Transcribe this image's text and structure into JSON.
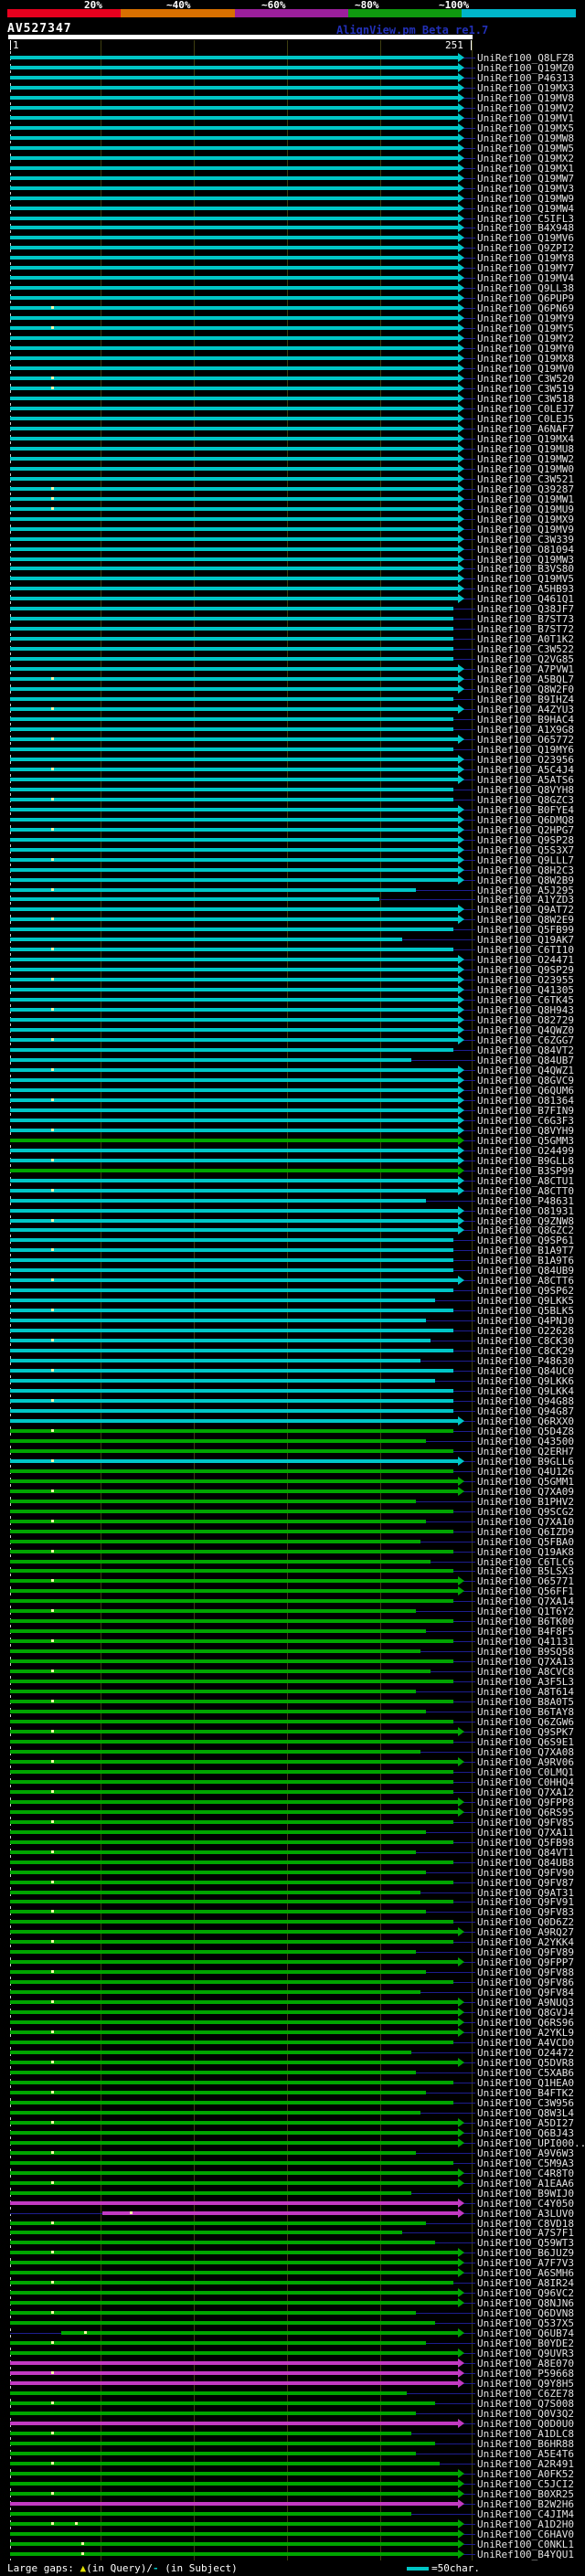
{
  "header": {
    "identity_key": {
      "labels": [
        "20%",
        "~40%",
        "~60%",
        "~80%",
        "~100%"
      ],
      "colors": [
        "#e8001e",
        "#d97000",
        "#9c1f9c",
        "#0f9b0f",
        "#00b7cb"
      ]
    },
    "title": "AV527347",
    "app_title": "AlignView.pm Beta re1.7"
  },
  "scale": {
    "start_label": "1",
    "end_label": "251"
  },
  "legend": {
    "large_gaps_prefix": "Large gaps: ",
    "triangle_symbol": "▲",
    "query_text": "(in Query)/",
    "dash_symbol": "-",
    "subject_text": " (in Subject)",
    "scale_swatch_label": "=50char."
  },
  "label_prefix": "UniRef100_",
  "colors": {
    "cyan": "#00c6c6",
    "green": "#00a400",
    "magenta": "#c23ac2",
    "connector": "#1d1d8f",
    "grid": "#3e3e10",
    "marker": "#f5f5a5"
  },
  "chart_data": {
    "type": "bar",
    "subtype": "sequence-alignment-coverage",
    "title": "AV527347",
    "x_axis": {
      "min": 1,
      "max": 251,
      "tick_interval": 50
    },
    "identity_bins": [
      "20%",
      "~40%",
      "~60%",
      "~80%",
      "~100%"
    ],
    "row_format": "[accession_suffix, color(c=cyan,g=green,m=magenta), arrowhead(1/0), end_fraction(optional), gap_marker_fractions(optional), start_fraction(optional)]",
    "rows": [
      [
        "Q8LFZ8",
        "c",
        1
      ],
      [
        "Q19MZ0",
        "c",
        1
      ],
      [
        "P46313",
        "c",
        1
      ],
      [
        "Q19MX3",
        "c",
        1
      ],
      [
        "Q19MV8",
        "c",
        1
      ],
      [
        "Q19MV2",
        "c",
        1
      ],
      [
        "Q19MV1",
        "c",
        1
      ],
      [
        "Q19MX5",
        "c",
        1
      ],
      [
        "Q19MW8",
        "c",
        1
      ],
      [
        "Q19MW5",
        "c",
        1
      ],
      [
        "Q19MX2",
        "c",
        1
      ],
      [
        "Q19MX1",
        "c",
        1
      ],
      [
        "Q19MW7",
        "c",
        1
      ],
      [
        "Q19MV3",
        "c",
        1
      ],
      [
        "Q19MW9",
        "c",
        1
      ],
      [
        "Q19MW4",
        "c",
        1
      ],
      [
        "C5IFL3",
        "c",
        1
      ],
      [
        "B4X948",
        "c",
        1
      ],
      [
        "Q19MV6",
        "c",
        1
      ],
      [
        "Q9ZPI2",
        "c",
        1
      ],
      [
        "Q19MY8",
        "c",
        1
      ],
      [
        "Q19MY7",
        "c",
        1
      ],
      [
        "Q19MV4",
        "c",
        1
      ],
      [
        "Q9LL38",
        "c",
        1
      ],
      [
        "Q6PUP9",
        "c",
        1
      ],
      [
        "Q6PN69",
        "c",
        1,
        null,
        [
          0.09
        ]
      ],
      [
        "Q19MY9",
        "c",
        1
      ],
      [
        "Q19MY5",
        "c",
        1,
        null,
        [
          0.09
        ]
      ],
      [
        "Q19MY2",
        "c",
        1
      ],
      [
        "Q19MY0",
        "c",
        1
      ],
      [
        "Q19MX8",
        "c",
        1
      ],
      [
        "Q19MV0",
        "c",
        1
      ],
      [
        "C3W520",
        "c",
        1,
        null,
        [
          0.09
        ]
      ],
      [
        "C3W519",
        "c",
        1,
        null,
        [
          0.09
        ]
      ],
      [
        "C3W518",
        "c",
        1
      ],
      [
        "C0LEJ7",
        "c",
        1
      ],
      [
        "C0LEJ5",
        "c",
        1
      ],
      [
        "A6NAF7",
        "c",
        1
      ],
      [
        "Q19MX4",
        "c",
        1
      ],
      [
        "Q19MU8",
        "c",
        1
      ],
      [
        "Q19MW2",
        "c",
        1
      ],
      [
        "Q19MW0",
        "c",
        1
      ],
      [
        "C3W521",
        "c",
        1
      ],
      [
        "Q39287",
        "c",
        1,
        null,
        [
          0.09
        ]
      ],
      [
        "Q19MW1",
        "c",
        1,
        null,
        [
          0.09
        ]
      ],
      [
        "Q19MU9",
        "c",
        1,
        null,
        [
          0.09
        ]
      ],
      [
        "Q19MX9",
        "c",
        1
      ],
      [
        "Q19MV9",
        "c",
        1
      ],
      [
        "C3W339",
        "c",
        1
      ],
      [
        "O81094",
        "c",
        1
      ],
      [
        "Q19MW3",
        "c",
        1
      ],
      [
        "B3VS80",
        "c",
        1
      ],
      [
        "Q19MV5",
        "c",
        1
      ],
      [
        "A5HB93",
        "c",
        1
      ],
      [
        "Q461Q1",
        "c",
        1
      ],
      [
        "Q38JF7",
        "c",
        0
      ],
      [
        "B7ST73",
        "c",
        0
      ],
      [
        "B7ST72",
        "c",
        0
      ],
      [
        "A0T1K2",
        "c",
        0
      ],
      [
        "C3W522",
        "c",
        0
      ],
      [
        "Q2VG85",
        "c",
        0
      ],
      [
        "A7PVW1",
        "c",
        1
      ],
      [
        "A5BQL7",
        "c",
        1,
        null,
        [
          0.09
        ]
      ],
      [
        "Q8W2F0",
        "c",
        1
      ],
      [
        "B9IHZ4",
        "c",
        0
      ],
      [
        "A4ZYU3",
        "c",
        1,
        null,
        [
          0.09
        ]
      ],
      [
        "B9HAC4",
        "c",
        0
      ],
      [
        "A1X9G8",
        "c",
        0
      ],
      [
        "O65772",
        "c",
        1,
        null,
        [
          0.09
        ]
      ],
      [
        "Q19MY6",
        "c",
        0
      ],
      [
        "O23956",
        "c",
        1
      ],
      [
        "A5C4J4",
        "c",
        1,
        null,
        [
          0.09
        ]
      ],
      [
        "A5ATS6",
        "c",
        1
      ],
      [
        "Q8VYH8",
        "c",
        0
      ],
      [
        "Q8GZC3",
        "c",
        0,
        null,
        [
          0.09
        ]
      ],
      [
        "B0FYE4",
        "c",
        1
      ],
      [
        "Q6DMQ8",
        "c",
        1
      ],
      [
        "Q2HPG7",
        "c",
        1,
        null,
        [
          0.09
        ]
      ],
      [
        "Q9SP28",
        "c",
        1
      ],
      [
        "Q5S3X7",
        "c",
        1
      ],
      [
        "Q9LLL7",
        "c",
        1,
        null,
        [
          0.09
        ]
      ],
      [
        "Q8H2C3",
        "c",
        1
      ],
      [
        "Q8W2B9",
        "c",
        1
      ],
      [
        "A5J295",
        "c",
        0,
        0.88,
        [
          0.09
        ]
      ],
      [
        "A1YZD3",
        "c",
        0,
        0.8
      ],
      [
        "Q9AT72",
        "c",
        1
      ],
      [
        "Q8W2E9",
        "c",
        1,
        null,
        [
          0.09
        ]
      ],
      [
        "Q5FB99",
        "c",
        0
      ],
      [
        "Q19AK7",
        "c",
        0,
        0.85
      ],
      [
        "C6TI10",
        "c",
        0,
        null,
        [
          0.09
        ]
      ],
      [
        "O24471",
        "c",
        1
      ],
      [
        "Q9SP29",
        "c",
        1
      ],
      [
        "O23955",
        "c",
        1,
        null,
        [
          0.09
        ]
      ],
      [
        "Q41305",
        "c",
        1
      ],
      [
        "C6TK45",
        "c",
        1
      ],
      [
        "Q8H943",
        "c",
        1,
        null,
        [
          0.09
        ]
      ],
      [
        "O82729",
        "c",
        1
      ],
      [
        "Q4QWZ0",
        "c",
        1
      ],
      [
        "C6ZGG7",
        "c",
        1,
        null,
        [
          0.09
        ]
      ],
      [
        "Q84VT2",
        "c",
        0
      ],
      [
        "Q84UB7",
        "c",
        0,
        0.87
      ],
      [
        "Q4QWZ1",
        "c",
        1,
        null,
        [
          0.09
        ]
      ],
      [
        "Q8GVC9",
        "c",
        1
      ],
      [
        "Q6QUM6",
        "c",
        1
      ],
      [
        "O81364",
        "c",
        1,
        null,
        [
          0.09
        ]
      ],
      [
        "B7FIN9",
        "c",
        1
      ],
      [
        "C6G3F3",
        "c",
        1
      ],
      [
        "Q8VYH9",
        "c",
        1,
        null,
        [
          0.09
        ]
      ],
      [
        "Q5GMM3",
        "g",
        1
      ],
      [
        "O24499",
        "c",
        1
      ],
      [
        "B9GLL8",
        "c",
        1,
        null,
        [
          0.09
        ]
      ],
      [
        "B3SP99",
        "g",
        1
      ],
      [
        "A8CTU1",
        "c",
        1
      ],
      [
        "A8CTT0",
        "c",
        1,
        null,
        [
          0.09
        ]
      ],
      [
        "P48631",
        "c",
        0,
        0.9
      ],
      [
        "O81931",
        "c",
        1
      ],
      [
        "Q9ZNW8",
        "c",
        1,
        null,
        [
          0.09
        ]
      ],
      [
        "Q8GZC2",
        "c",
        1
      ],
      [
        "Q9SP61",
        "c",
        0
      ],
      [
        "B1A9T7",
        "c",
        0,
        null,
        [
          0.09
        ]
      ],
      [
        "B1A9T6",
        "c",
        0
      ],
      [
        "Q84UB9",
        "c",
        0
      ],
      [
        "A8CTT6",
        "c",
        1,
        null,
        [
          0.09
        ]
      ],
      [
        "Q9SP62",
        "c",
        0
      ],
      [
        "Q9LKK5",
        "c",
        0,
        0.92
      ],
      [
        "Q5BLK5",
        "c",
        0,
        null,
        [
          0.09
        ]
      ],
      [
        "Q4PNJ0",
        "c",
        0,
        0.9
      ],
      [
        "O22628",
        "c",
        0
      ],
      [
        "C8CK30",
        "c",
        0,
        0.91,
        [
          0.09
        ]
      ],
      [
        "C8CK29",
        "c",
        0
      ],
      [
        "P48630",
        "c",
        0,
        0.89
      ],
      [
        "Q84UC0",
        "c",
        0,
        null,
        [
          0.09
        ]
      ],
      [
        "Q9LKK6",
        "c",
        0,
        0.92
      ],
      [
        "Q9LKK4",
        "c",
        0
      ],
      [
        "Q94G88",
        "c",
        0,
        null,
        [
          0.09
        ]
      ],
      [
        "Q94G87",
        "c",
        0
      ],
      [
        "Q6RXX0",
        "c",
        1
      ],
      [
        "Q5D4Z8",
        "g",
        0,
        null,
        [
          0.09
        ]
      ],
      [
        "Q43500",
        "g",
        0,
        0.9
      ],
      [
        "Q2ERH7",
        "g",
        0
      ],
      [
        "B9GLL6",
        "c",
        1,
        null,
        [
          0.09
        ]
      ],
      [
        "Q4U126",
        "g",
        0
      ],
      [
        "Q5GMM1",
        "g",
        1
      ],
      [
        "Q7XA09",
        "g",
        1,
        null,
        [
          0.09
        ]
      ],
      [
        "B1PHV2",
        "g",
        0,
        0.88
      ],
      [
        "Q9SCG2",
        "g",
        0
      ],
      [
        "Q7XA10",
        "g",
        0,
        0.9,
        [
          0.09
        ]
      ],
      [
        "Q6IZD9",
        "g",
        0
      ],
      [
        "Q5FBA0",
        "g",
        0,
        0.89
      ],
      [
        "Q19AK8",
        "g",
        0,
        null,
        [
          0.09
        ]
      ],
      [
        "C6TLC6",
        "g",
        0,
        0.91
      ],
      [
        "B5LSX3",
        "g",
        0
      ],
      [
        "O65771",
        "g",
        1,
        null,
        [
          0.09
        ]
      ],
      [
        "Q56FF1",
        "g",
        1
      ],
      [
        "Q7XA14",
        "g",
        0
      ],
      [
        "Q1T6Y2",
        "g",
        0,
        0.88,
        [
          0.09
        ]
      ],
      [
        "B6TK00",
        "g",
        0
      ],
      [
        "B4F8F5",
        "g",
        0,
        0.9
      ],
      [
        "Q41131",
        "g",
        0,
        null,
        [
          0.09
        ]
      ],
      [
        "B9SQ58",
        "g",
        0,
        0.89
      ],
      [
        "Q7XA13",
        "g",
        0
      ],
      [
        "A8CVC8",
        "g",
        0,
        0.91,
        [
          0.09
        ]
      ],
      [
        "A3F5L3",
        "g",
        0
      ],
      [
        "A8T614",
        "g",
        0,
        0.88
      ],
      [
        "B8A0T5",
        "g",
        0,
        null,
        [
          0.09
        ]
      ],
      [
        "B6TAY8",
        "g",
        0,
        0.9
      ],
      [
        "Q6ZGW6",
        "g",
        0
      ],
      [
        "Q9SPK7",
        "g",
        1,
        null,
        [
          0.09
        ]
      ],
      [
        "Q6S9E1",
        "g",
        0
      ],
      [
        "Q7XA08",
        "g",
        0,
        0.89
      ],
      [
        "A9RV06",
        "g",
        1,
        null,
        [
          0.09
        ]
      ],
      [
        "C0LMQ1",
        "g",
        0
      ],
      [
        "C0HHQ4",
        "g",
        0
      ],
      [
        "Q7XA12",
        "g",
        0,
        null,
        [
          0.09
        ]
      ],
      [
        "Q9FPP8",
        "g",
        1
      ],
      [
        "Q6RS95",
        "g",
        1
      ],
      [
        "Q9FV85",
        "g",
        0,
        null,
        [
          0.09
        ]
      ],
      [
        "Q7XA11",
        "g",
        0,
        0.9
      ],
      [
        "Q5FB98",
        "g",
        0
      ],
      [
        "Q84VT1",
        "g",
        0,
        0.88,
        [
          0.09
        ]
      ],
      [
        "Q84UB8",
        "g",
        0
      ],
      [
        "Q9FV90",
        "g",
        0,
        0.9
      ],
      [
        "Q9FV87",
        "g",
        0,
        null,
        [
          0.09
        ]
      ],
      [
        "Q9AT31",
        "g",
        0,
        0.89
      ],
      [
        "Q9FV91",
        "g",
        0
      ],
      [
        "Q9FV83",
        "g",
        0,
        0.9,
        [
          0.09
        ]
      ],
      [
        "Q0D6Z2",
        "g",
        0
      ],
      [
        "A9RQ27",
        "g",
        1
      ],
      [
        "A2YKK4",
        "g",
        0,
        null,
        [
          0.09
        ]
      ],
      [
        "Q9FV89",
        "g",
        0,
        0.88
      ],
      [
        "Q9FPP7",
        "g",
        1
      ],
      [
        "Q9FV88",
        "g",
        0,
        0.9,
        [
          0.09
        ]
      ],
      [
        "Q9FV86",
        "g",
        0
      ],
      [
        "Q9FV84",
        "g",
        0,
        0.89
      ],
      [
        "A9NUQ3",
        "g",
        1,
        null,
        [
          0.09
        ]
      ],
      [
        "Q8GVJ4",
        "g",
        1
      ],
      [
        "Q6RS96",
        "g",
        1
      ],
      [
        "A2YKL9",
        "g",
        1,
        null,
        [
          0.09
        ]
      ],
      [
        "A4VCD0",
        "g",
        0
      ],
      [
        "O24472",
        "g",
        0,
        0.87
      ],
      [
        "Q5DVR8",
        "g",
        1,
        null,
        [
          0.09
        ]
      ],
      [
        "C5XAB6",
        "g",
        0,
        0.88
      ],
      [
        "Q1HEA0",
        "g",
        0
      ],
      [
        "B4FTK2",
        "g",
        0,
        0.9,
        [
          0.09
        ]
      ],
      [
        "C3W956",
        "g",
        0
      ],
      [
        "Q8W3L4",
        "g",
        0,
        0.89
      ],
      [
        "A5DI27",
        "g",
        1,
        null,
        [
          0.09
        ]
      ],
      [
        "Q6BJ43",
        "g",
        1
      ],
      [
        "UPI000..",
        "g",
        1
      ],
      [
        "A9V6W3",
        "g",
        0,
        0.88,
        [
          0.09
        ]
      ],
      [
        "C5M9A3",
        "g",
        0
      ],
      [
        "C4R8T0",
        "g",
        1
      ],
      [
        "A1EAA6",
        "g",
        1,
        null,
        [
          0.09
        ]
      ],
      [
        "B9WIJ0",
        "g",
        0,
        0.87
      ],
      [
        "C4Y050",
        "m",
        1
      ],
      [
        "A3LUV0",
        "m",
        1,
        null,
        [
          0.26
        ],
        0.2
      ],
      [
        "C8VD18",
        "g",
        0,
        0.9,
        [
          0.09
        ]
      ],
      [
        "A7S7F1",
        "g",
        0,
        0.85
      ],
      [
        "Q59WT3",
        "g",
        0,
        0.92
      ],
      [
        "B6JUZ9",
        "g",
        1,
        null,
        [
          0.09
        ]
      ],
      [
        "A7F7V3",
        "g",
        1
      ],
      [
        "A6SMH6",
        "g",
        1
      ],
      [
        "A8IR24",
        "g",
        0,
        null,
        [
          0.09
        ]
      ],
      [
        "Q96VC2",
        "g",
        1
      ],
      [
        "Q8NJN6",
        "g",
        1
      ],
      [
        "Q6DVN8",
        "g",
        0,
        0.88,
        [
          0.09
        ]
      ],
      [
        "Q537X5",
        "g",
        0,
        0.92
      ],
      [
        "Q6UB74",
        "g",
        1,
        null,
        [
          0.16
        ],
        0.11
      ],
      [
        "B0YDE2",
        "g",
        0,
        0.9,
        [
          0.09
        ]
      ],
      [
        "Q9UVR3",
        "g",
        1
      ],
      [
        "A8E070",
        "m",
        1
      ],
      [
        "P59668",
        "m",
        1,
        null,
        [
          0.09
        ]
      ],
      [
        "Q9Y8H5",
        "m",
        1
      ],
      [
        "C6ZE78",
        "g",
        0,
        0.86
      ],
      [
        "Q7S008",
        "g",
        0,
        0.92,
        [
          0.09
        ]
      ],
      [
        "Q0V3Q2",
        "g",
        0,
        0.88
      ],
      [
        "Q0D0U0",
        "m",
        1
      ],
      [
        "A1DLC8",
        "g",
        0,
        0.87,
        [
          0.09
        ]
      ],
      [
        "B6HR88",
        "g",
        0,
        0.92
      ],
      [
        "A5E4T6",
        "g",
        0,
        0.88
      ],
      [
        "A2R491",
        "g",
        0,
        0.93,
        [
          0.09
        ]
      ],
      [
        "A0FK52",
        "g",
        1
      ],
      [
        "C5JCI2",
        "g",
        1
      ],
      [
        "B0XR25",
        "g",
        1,
        null,
        [
          0.09
        ]
      ],
      [
        "B2W2H6",
        "m",
        1
      ],
      [
        "C4JIM4",
        "g",
        0,
        0.87
      ],
      [
        "A1D2H0",
        "g",
        1,
        null,
        [
          0.09,
          0.14
        ]
      ],
      [
        "C6HAV0",
        "g",
        1
      ],
      [
        "C0NKL1",
        "g",
        1,
        null,
        [
          0.155
        ]
      ],
      [
        "B4YQU1",
        "g",
        1,
        null,
        [
          0.155
        ]
      ]
    ]
  }
}
